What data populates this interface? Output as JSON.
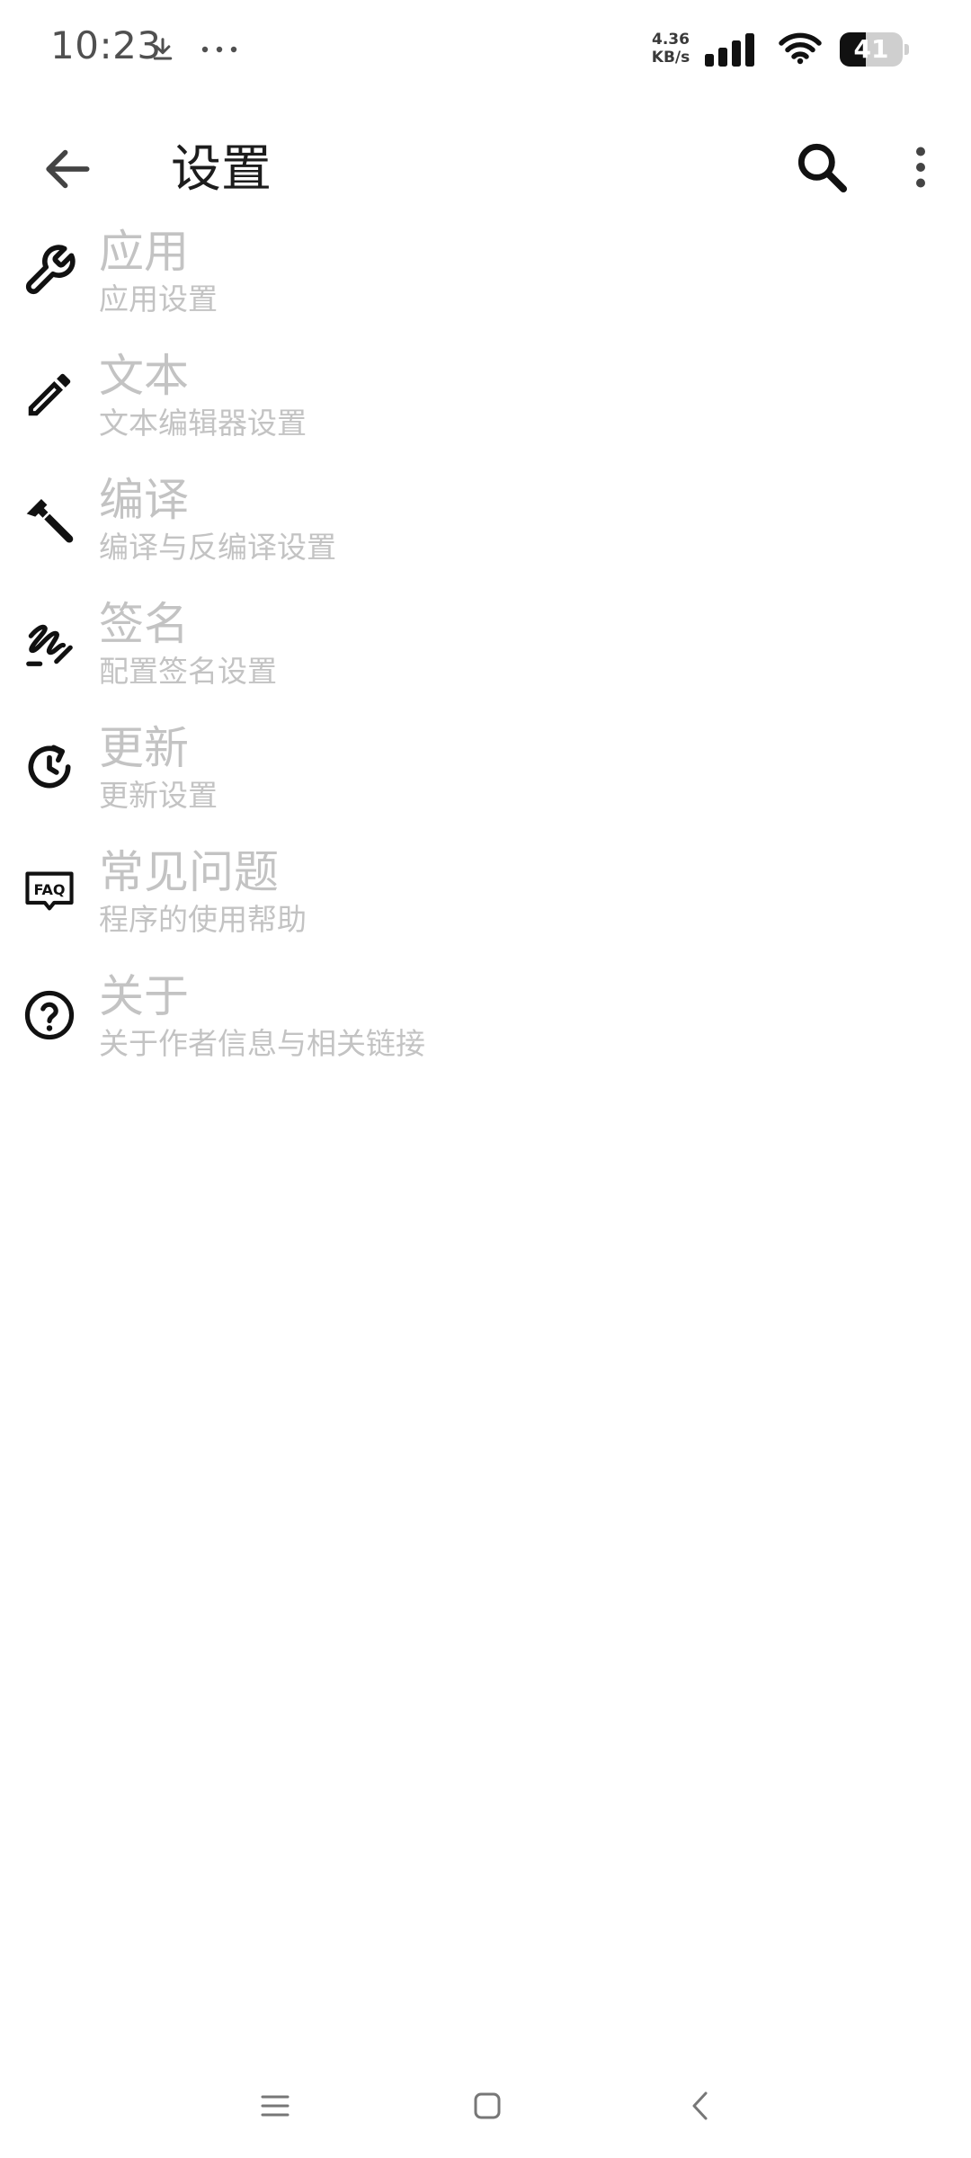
{
  "status_bar": {
    "time": "10:23",
    "net_speed_value": "4.36",
    "net_speed_unit": "KB/s",
    "battery_level": "41",
    "battery_fraction": 0.41,
    "download_icon": "download-icon",
    "more_icon": "more-horizontal-icon",
    "signal_icon": "cellular-signal-icon",
    "wifi_icon": "wifi-icon"
  },
  "app_bar": {
    "title": "设置",
    "back_icon": "arrow-back-icon",
    "search_icon": "search-icon",
    "overflow_icon": "more-vertical-icon"
  },
  "settings": {
    "items": [
      {
        "title": "应用",
        "subtitle": "应用设置",
        "icon": "wrench-icon"
      },
      {
        "title": "文本",
        "subtitle": "文本编辑器设置",
        "icon": "pencil-icon"
      },
      {
        "title": "编译",
        "subtitle": "编译与反编译设置",
        "icon": "hammer-icon"
      },
      {
        "title": "签名",
        "subtitle": "配置签名设置",
        "icon": "signature-icon"
      },
      {
        "title": "更新",
        "subtitle": "更新设置",
        "icon": "update-icon"
      },
      {
        "title": "常见问题",
        "subtitle": "程序的使用帮助",
        "icon": "faq-icon"
      },
      {
        "title": "关于",
        "subtitle": "关于作者信息与相关链接",
        "icon": "help-circle-icon"
      }
    ]
  },
  "nav_bar": {
    "menu_icon": "menu-icon",
    "home_icon": "home-icon",
    "back_icon": "back-chevron-icon"
  },
  "colors": {
    "background": "#ffffff",
    "icon": "#000000",
    "title": "#1c1c1c",
    "disabled_text": "#c3c3c3"
  }
}
